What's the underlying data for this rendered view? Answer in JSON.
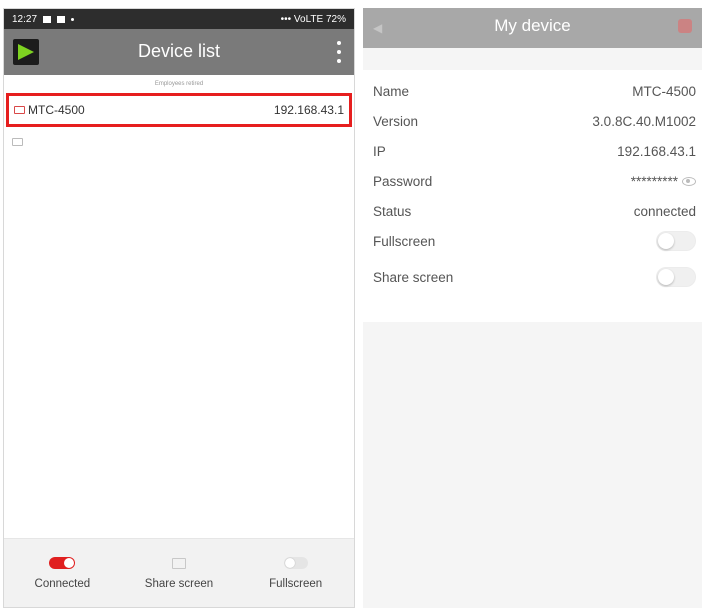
{
  "left": {
    "status_bar": {
      "time": "12:27",
      "right": "••• VoLTE 72%"
    },
    "app_title": "Device list",
    "list_header": "Employees retired",
    "devices": [
      {
        "name": "MTC-4500",
        "ip": "192.168.43.1",
        "selected": true
      },
      {
        "name": "",
        "ip": "",
        "selected": false
      }
    ],
    "bottom": {
      "connected": "Connected",
      "share_screen": "Share screen",
      "fullscreen": "Fullscreen"
    },
    "colors": {
      "appbar": "#7a7a7a",
      "accent": "#e02020",
      "logo_green": "#7ed321"
    }
  },
  "right": {
    "title": "My device",
    "rows": {
      "name": {
        "label": "Name",
        "value": "MTC-4500"
      },
      "version": {
        "label": "Version",
        "value": "3.0.8C.40.M1002"
      },
      "ip": {
        "label": "IP",
        "value": "192.168.43.1"
      },
      "password": {
        "label": "Password",
        "value": "*********"
      },
      "status": {
        "label": "Status",
        "value": "connected"
      },
      "fullscreen": {
        "label": "Fullscreen",
        "on": false
      },
      "share_screen": {
        "label": "Share screen",
        "on": false
      }
    }
  }
}
